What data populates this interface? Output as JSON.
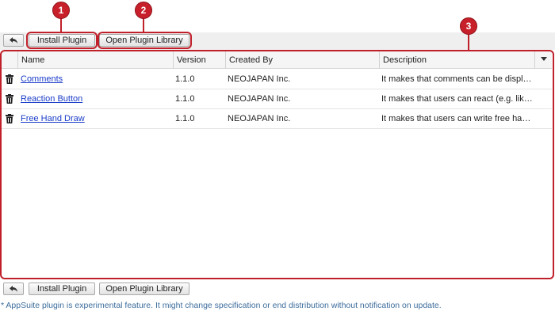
{
  "toolbar": {
    "back_icon": "back-arrow-icon",
    "install_plugin_label": "Install Plugin",
    "open_plugin_library_label": "Open Plugin Library"
  },
  "callouts": [
    "1",
    "2",
    "3"
  ],
  "table": {
    "columns": [
      "Name",
      "Version",
      "Created By",
      "Description"
    ],
    "rows": [
      {
        "name": "Comments",
        "version": "1.1.0",
        "created_by": "NEOJAPAN Inc.",
        "description": "It makes that comments can be display…"
      },
      {
        "name": "Reaction Button",
        "version": "1.1.0",
        "created_by": "NEOJAPAN Inc.",
        "description": "It makes that users can react (e.g. like) …"
      },
      {
        "name": "Free Hand Draw",
        "version": "1.1.0",
        "created_by": "NEOJAPAN Inc.",
        "description": "It makes that users can write free hand …"
      }
    ]
  },
  "footnote": "* AppSuite plugin is experimental feature. It might change specification or end distribution without notification on update.",
  "colors": {
    "callout": "#c8202a",
    "link": "#1a3cc8",
    "footnote": "#3c6c9c"
  }
}
